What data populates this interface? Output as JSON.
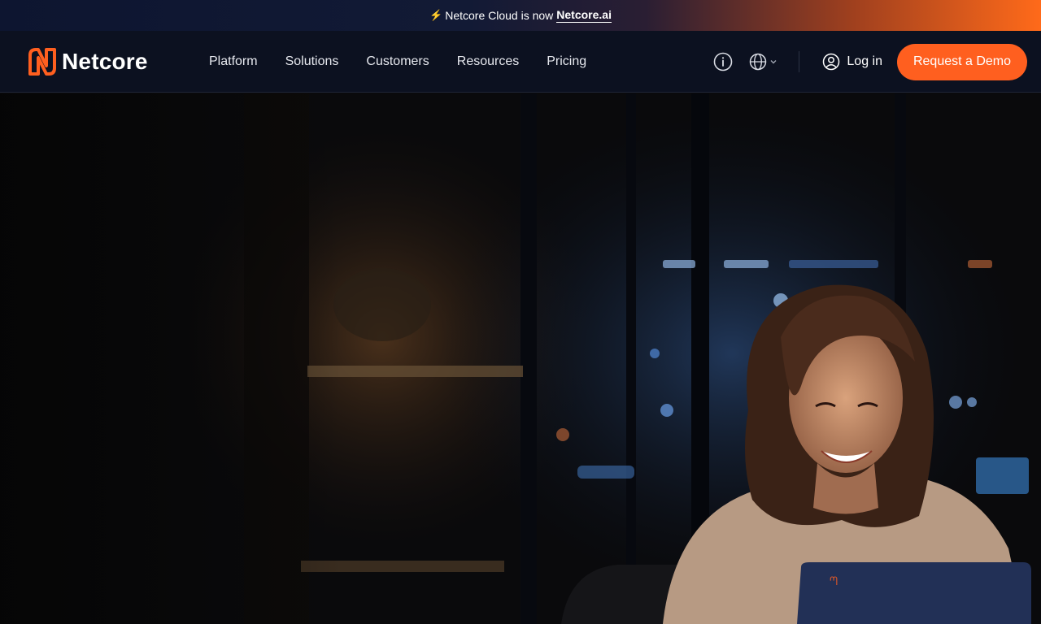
{
  "announcement": {
    "prefix": "Netcore Cloud is now",
    "link": "Netcore.ai",
    "bolt_icon": "lightning-icon"
  },
  "brand": {
    "name": "Netcore",
    "accent": "#ff5f1f"
  },
  "nav": {
    "items": [
      "Platform",
      "Solutions",
      "Customers",
      "Resources",
      "Pricing"
    ],
    "login_label": "Log in",
    "demo_label": "Request a Demo",
    "icons": [
      "info-icon",
      "globe-icon",
      "chevron-down-icon",
      "user-icon"
    ]
  },
  "colors": {
    "nav_bg": "#0c1120",
    "cta": "#ff5f1f",
    "text": "#ffffff"
  }
}
